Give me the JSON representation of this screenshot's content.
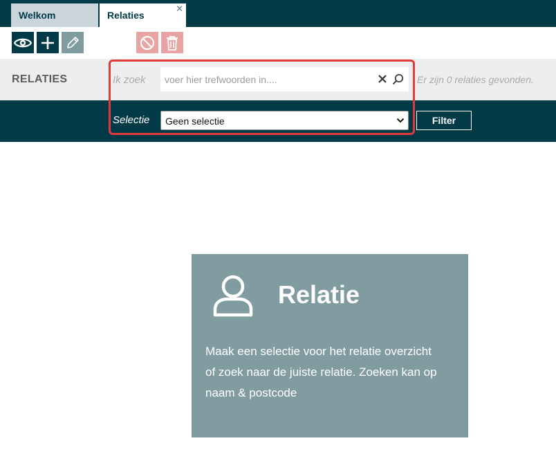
{
  "tabs": [
    {
      "label": "Welkom",
      "active": false
    },
    {
      "label": "Relaties",
      "active": true
    }
  ],
  "toolbar": {
    "buttons": [
      {
        "icon": "eye-icon",
        "state": "enabled"
      },
      {
        "icon": "plus-icon",
        "state": "enabled"
      },
      {
        "icon": "pencil-icon",
        "state": "disabled"
      },
      {
        "icon": "block-icon",
        "state": "disabled"
      },
      {
        "icon": "trash-icon",
        "state": "disabled"
      }
    ]
  },
  "search": {
    "section_title": "RELATIES",
    "label": "Ik zoek",
    "placeholder": "voer hier trefwoorden in....",
    "value": "",
    "result_text": "Er zijn 0 relaties gevonden."
  },
  "filter": {
    "label": "Selectie",
    "selected": "Geen selectie",
    "button_label": "Filter"
  },
  "card": {
    "title": "Relatie",
    "icon": "user-icon",
    "text": "Maak een selectie voor het relatie overzicht of zoek naar de juiste relatie. Zoeken kan op naam & postcode"
  },
  "colors": {
    "primary": "#033a48",
    "card": "#809ca1",
    "danger_disabled": "#e8a3a3",
    "highlight": "#e03a3a"
  }
}
